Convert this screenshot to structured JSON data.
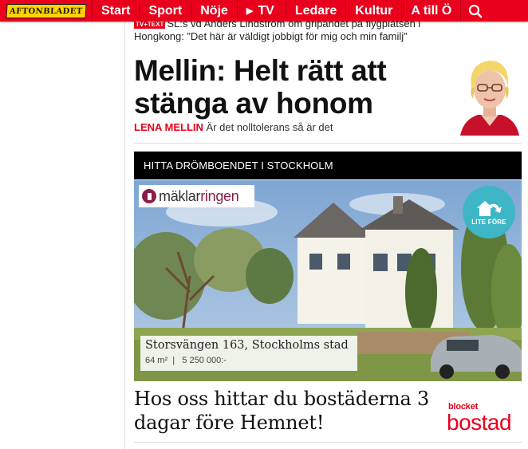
{
  "nav": {
    "logo": "AFTONBLADET",
    "items": [
      "Start",
      "Sport",
      "Nöje",
      "TV",
      "Ledare",
      "Kultur",
      "A till Ö"
    ],
    "brand_color": "#e8001c"
  },
  "ticker": {
    "badge": "TV+TEXT",
    "text": "SL:s vd Anders Lindström om gripandet på flygplatsen i Hongkong: ”Det här är väldigt jobbigt för mig och min familj”"
  },
  "article": {
    "headline": "Mellin: Helt rätt att stänga av honom",
    "author": "Lena Mellin",
    "lede": "Är det nolltolerans så är det"
  },
  "ad": {
    "section_label": "HITTA DRÖMBOENDET I STOCKHOLM",
    "brand_part1": "mäklar",
    "brand_part2": "ringen",
    "badge_text": "LITE FÖRE",
    "address": "Storsvängen 163, Stockholms stad",
    "size": "64 m²",
    "price": "5 250 000:-",
    "headline": "Hos oss hittar du bostäderna 3 dagar före Hemnet!",
    "partner_small": "blocket",
    "partner_big": "bostad",
    "accent_color": "#3fb6c6"
  }
}
